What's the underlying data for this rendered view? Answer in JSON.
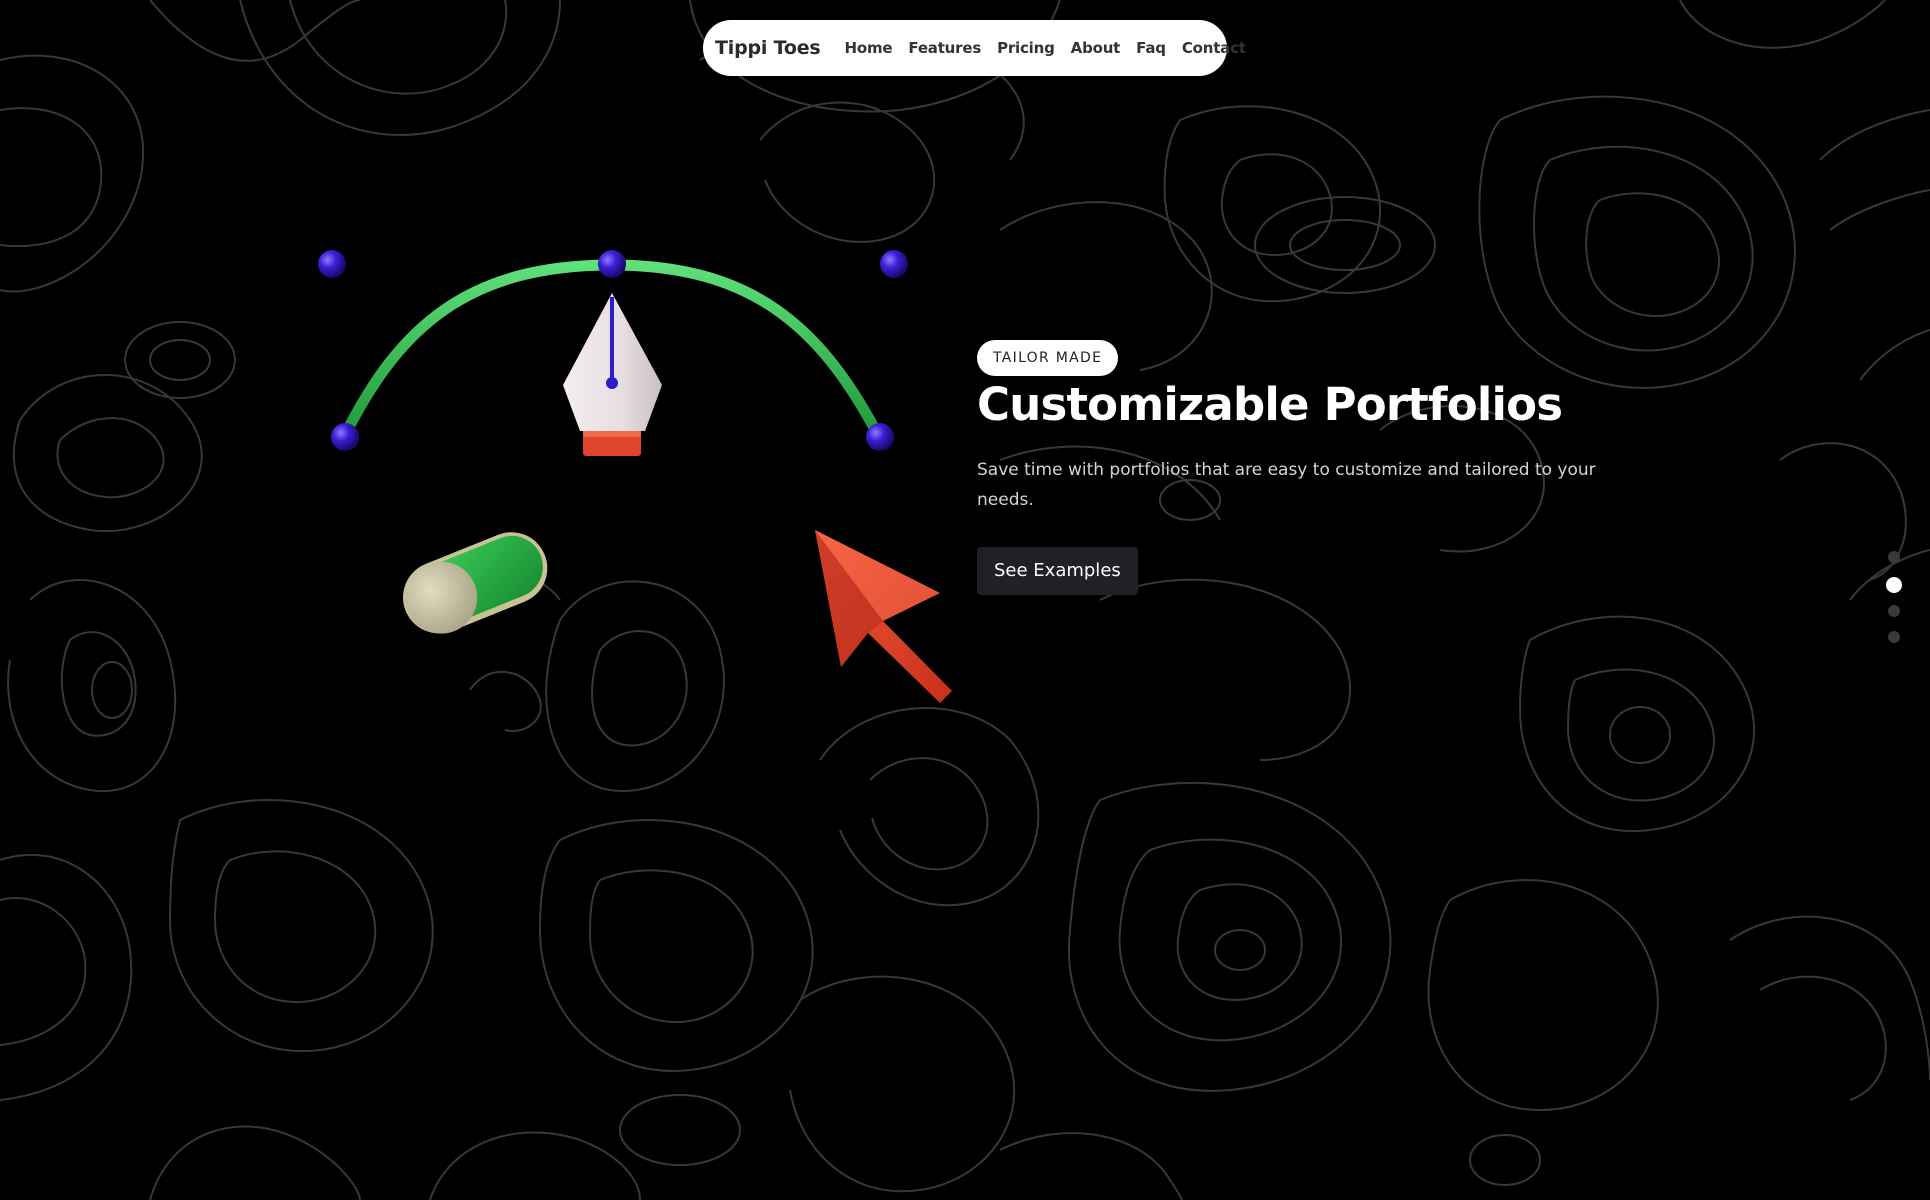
{
  "nav": {
    "brand": "Tippi Toes",
    "links": [
      "Home",
      "Features",
      "Pricing",
      "About",
      "Faq",
      "Contact"
    ]
  },
  "hero": {
    "badge": "TAILOR MADE",
    "title": "Customizable Portfolios",
    "description": "Save time with portfolios that are easy to customize and tailored to your needs.",
    "cta_label": "See Examples"
  },
  "pagination": {
    "count": 4,
    "active_index": 1
  },
  "colors": {
    "background": "#000000",
    "contour_lines": "#3a3a3a",
    "nav_bg": "#ffffff",
    "button_bg": "#1f2124",
    "curve_green": "#2fb84f",
    "anchor_blue": "#3a1fd6",
    "cursor_red": "#e0442a",
    "pen_tip": "#ece4e7"
  },
  "icons": [
    "bezier-pen-tool-icon",
    "toggle-switch-icon",
    "cursor-arrow-icon"
  ]
}
